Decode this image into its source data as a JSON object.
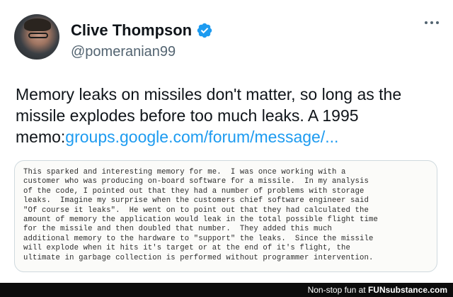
{
  "author": {
    "name": "Clive Thompson",
    "handle": "@pomeranian99"
  },
  "tweet": {
    "text": "Memory leaks on missiles don't matter, so long as the missile explodes before too much leaks. A 1995 memo:",
    "link": "groups.google.com/forum/message/..."
  },
  "memo": {
    "lines": [
      "This sparked and interesting memory for me.  I was once working with a",
      "customer who was producing on-board software for a missile.  In my analysis",
      "of the code, I pointed out that they had a number of problems with storage",
      "leaks.  Imagine my surprise when the customers chief software engineer said",
      "\"Of course it leaks\".  He went on to point out that they had calculated the",
      "amount of memory the application would leak in the total possible flight time",
      "for the missile and then doubled that number.  They added this much",
      "additional memory to the hardware to \"support\" the leaks.  Since the missile",
      "will explode when it hits it's target or at the end of it's flight, the",
      "ultimate in garbage collection is performed without programmer intervention."
    ]
  },
  "footer": {
    "prefix": "Non-stop fun at ",
    "brand": "FUNsubstance.com"
  },
  "colors": {
    "link": "#1d9bf0",
    "verified": "#1d9bf0",
    "handle": "#536471"
  }
}
